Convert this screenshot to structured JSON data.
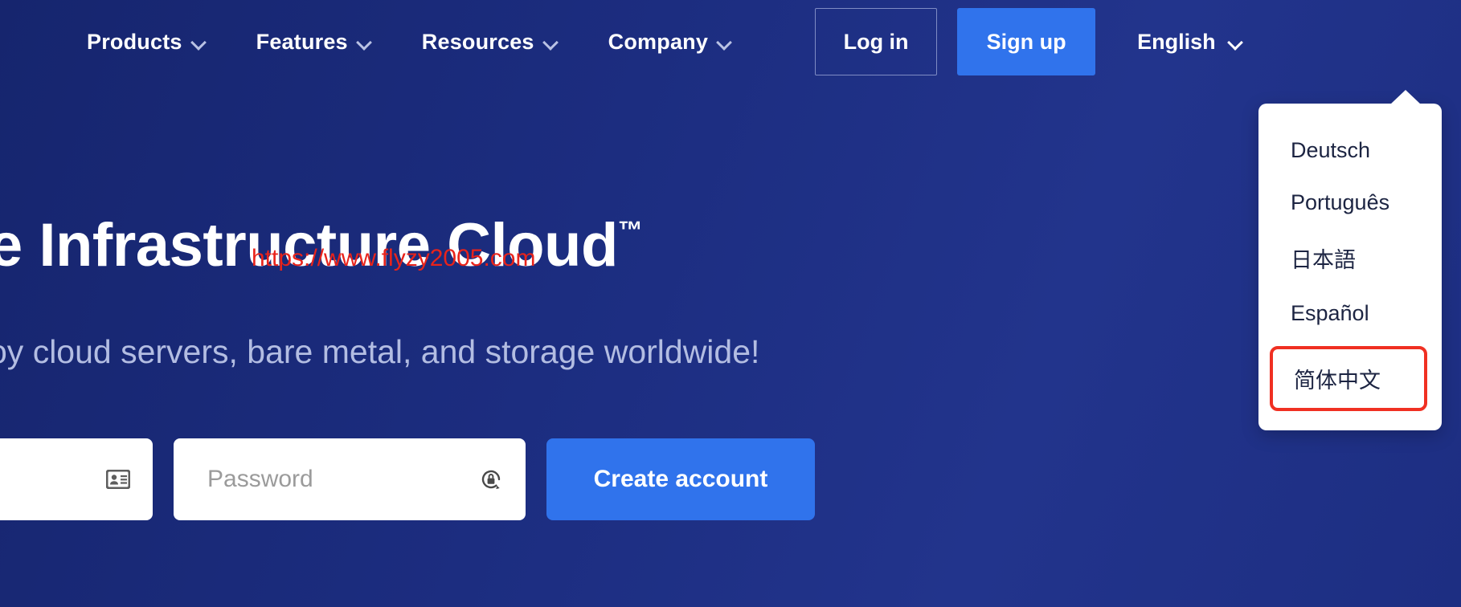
{
  "nav": {
    "items": [
      {
        "label": "Products",
        "icon": "chevron-down-icon"
      },
      {
        "label": "Features",
        "icon": "chevron-down-icon"
      },
      {
        "label": "Resources",
        "icon": "chevron-down-icon"
      },
      {
        "label": "Company",
        "icon": "chevron-down-icon"
      }
    ],
    "login_label": "Log in",
    "signup_label": "Sign up",
    "language_label": "English",
    "language_chevron_icon": "chevron-down-icon"
  },
  "language_menu": {
    "options": [
      {
        "label": "Deutsch",
        "highlighted": false
      },
      {
        "label": "Português",
        "highlighted": false
      },
      {
        "label": "日本語",
        "highlighted": false
      },
      {
        "label": "Español",
        "highlighted": false
      },
      {
        "label": "简体中文",
        "highlighted": true
      }
    ],
    "highlight_color": "#f03022"
  },
  "hero": {
    "title": "e Infrastructure Cloud",
    "trademark": "™",
    "subtitle": "oy cloud servers, bare metal, and storage worldwide!"
  },
  "watermark": {
    "text": "https://www.flyzy2005.com",
    "color": "#e8231b"
  },
  "signup_form": {
    "email_value": "",
    "email_icon": "contact-card-icon",
    "password_placeholder": "Password",
    "password_icon": "password-lock-icon",
    "create_account_label": "Create account"
  },
  "theme": {
    "background_start": "#16256e",
    "background_end": "#1d2e82",
    "accent_blue": "#3073ec",
    "subtitle_color": "#b3bde2"
  }
}
